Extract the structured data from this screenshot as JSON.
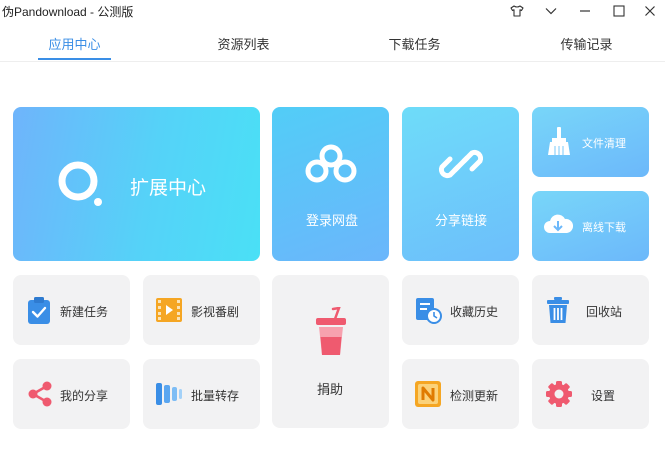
{
  "window": {
    "title": "伪Pandownload - 公测版"
  },
  "tabs": [
    {
      "label": "应用中心",
      "active": true
    },
    {
      "label": "资源列表",
      "active": false
    },
    {
      "label": "下载任务",
      "active": false
    },
    {
      "label": "传输记录",
      "active": false
    }
  ],
  "tiles": {
    "extension_center": "扩展中心",
    "login_netdisk": "登录网盘",
    "share_link": "分享链接",
    "file_cleanup": "文件清理",
    "offline_download": "离线下载",
    "new_task": "新建任务",
    "movies_series": "影视番剧",
    "donate": "捐助",
    "favorites_history": "收藏历史",
    "recycle_bin": "回收站",
    "my_shares": "我的分享",
    "batch_transfer": "批量转存",
    "check_update": "检测更新",
    "settings": "设置"
  },
  "colors": {
    "accent": "#3a8ee6",
    "tile_grey": "#f2f2f3",
    "blue_gradient_start": "#6fb4fb",
    "blue_gradient_end": "#4ae0f6"
  },
  "icons": [
    "shirt-icon",
    "chevron-down-icon",
    "minimize-icon",
    "maximize-icon",
    "close-icon",
    "ring-icon",
    "cloud-icon",
    "link-icon",
    "broom-icon",
    "cloud-download-icon",
    "clipboard-check-icon",
    "film-icon",
    "drink-cup-icon",
    "history-icon",
    "trash-icon",
    "share-icon",
    "bars-icon",
    "update-n-icon",
    "gear-icon"
  ]
}
